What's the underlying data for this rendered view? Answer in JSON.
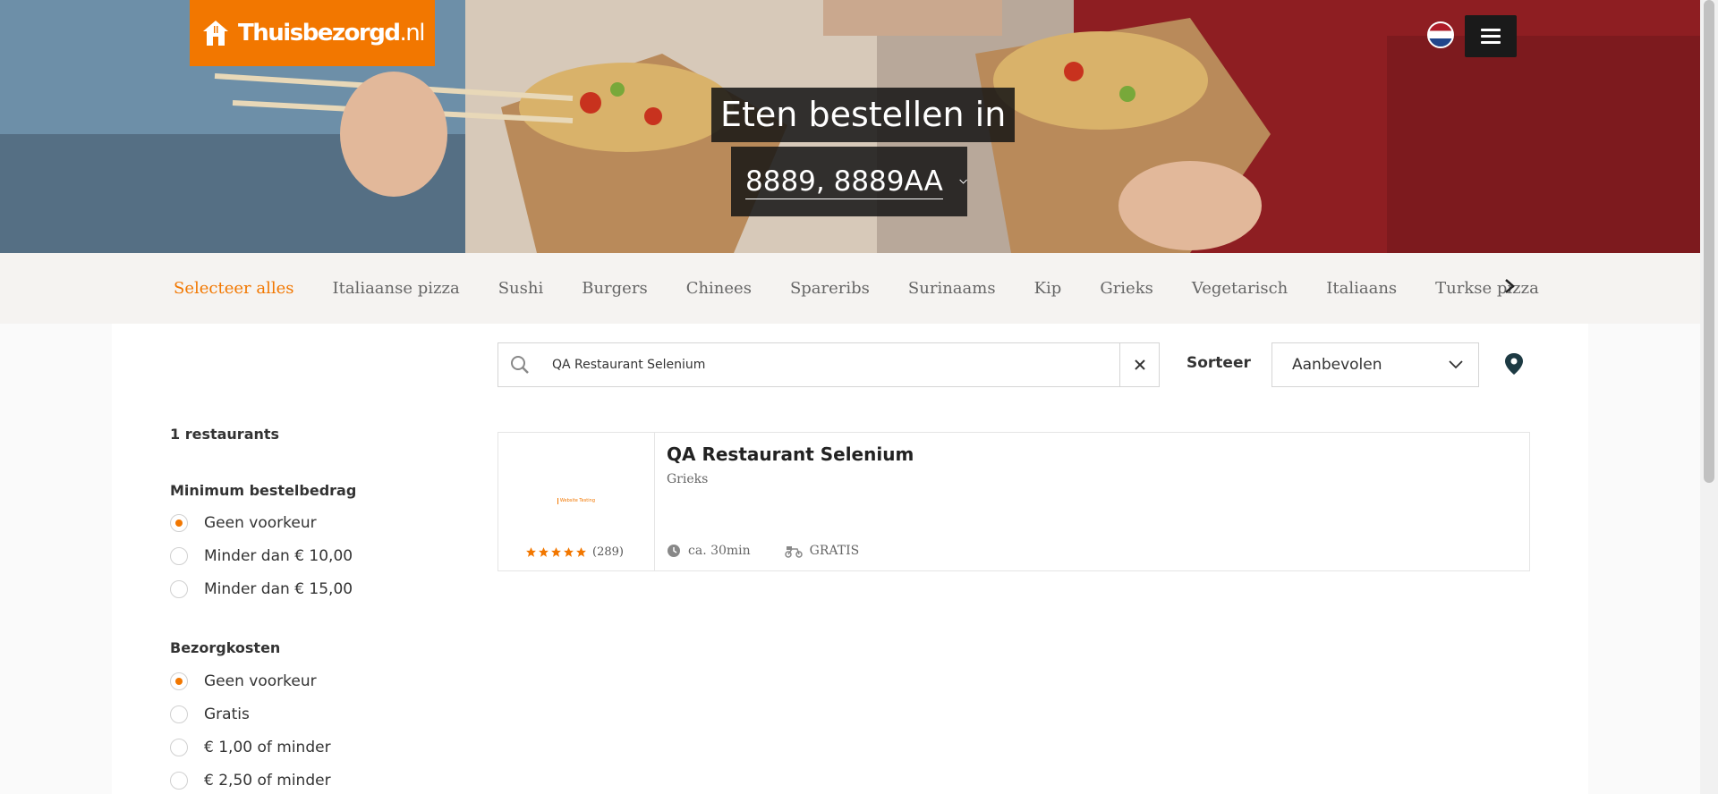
{
  "brand": {
    "name": "Thuisbezorgd",
    "tld": ".nl",
    "color": "#f27700"
  },
  "header": {
    "language_flag": "nl-flag-icon",
    "menu_icon": "hamburger-icon"
  },
  "hero": {
    "title": "Eten bestellen in",
    "address": "8889, 8889AA"
  },
  "categories": {
    "items": [
      {
        "label": "Selecteer alles",
        "active": true
      },
      {
        "label": "Italiaanse pizza"
      },
      {
        "label": "Sushi"
      },
      {
        "label": "Burgers"
      },
      {
        "label": "Chinees"
      },
      {
        "label": "Spareribs"
      },
      {
        "label": "Surinaams"
      },
      {
        "label": "Kip"
      },
      {
        "label": "Grieks"
      },
      {
        "label": "Vegetarisch"
      },
      {
        "label": "Italiaans"
      },
      {
        "label": "Turkse pizza"
      }
    ],
    "next_icon": "chevron-right-icon"
  },
  "search": {
    "value": "QA Restaurant Selenium",
    "placeholder": ""
  },
  "sort": {
    "label": "Sorteer",
    "selected": "Aanbevolen"
  },
  "results": {
    "count_label": "1 restaurants"
  },
  "filters": {
    "min_order": {
      "title": "Minimum bestelbedrag",
      "options": [
        {
          "label": "Geen voorkeur",
          "selected": true
        },
        {
          "label": "Minder dan € 10,00",
          "selected": false
        },
        {
          "label": "Minder dan € 15,00",
          "selected": false
        }
      ]
    },
    "delivery_cost": {
      "title": "Bezorgkosten",
      "options": [
        {
          "label": "Geen voorkeur",
          "selected": true
        },
        {
          "label": "Gratis",
          "selected": false
        },
        {
          "label": "€ 1,00 of minder",
          "selected": false
        },
        {
          "label": "€ 2,50 of minder",
          "selected": false
        }
      ]
    }
  },
  "restaurant": {
    "name": "QA Restaurant Selenium",
    "cuisine": "Grieks",
    "logo_text": "Website Testing",
    "rating_stars": 5,
    "rating_count": "(289)",
    "delivery_time": "ca. 30min",
    "delivery_cost": "GRATIS"
  }
}
